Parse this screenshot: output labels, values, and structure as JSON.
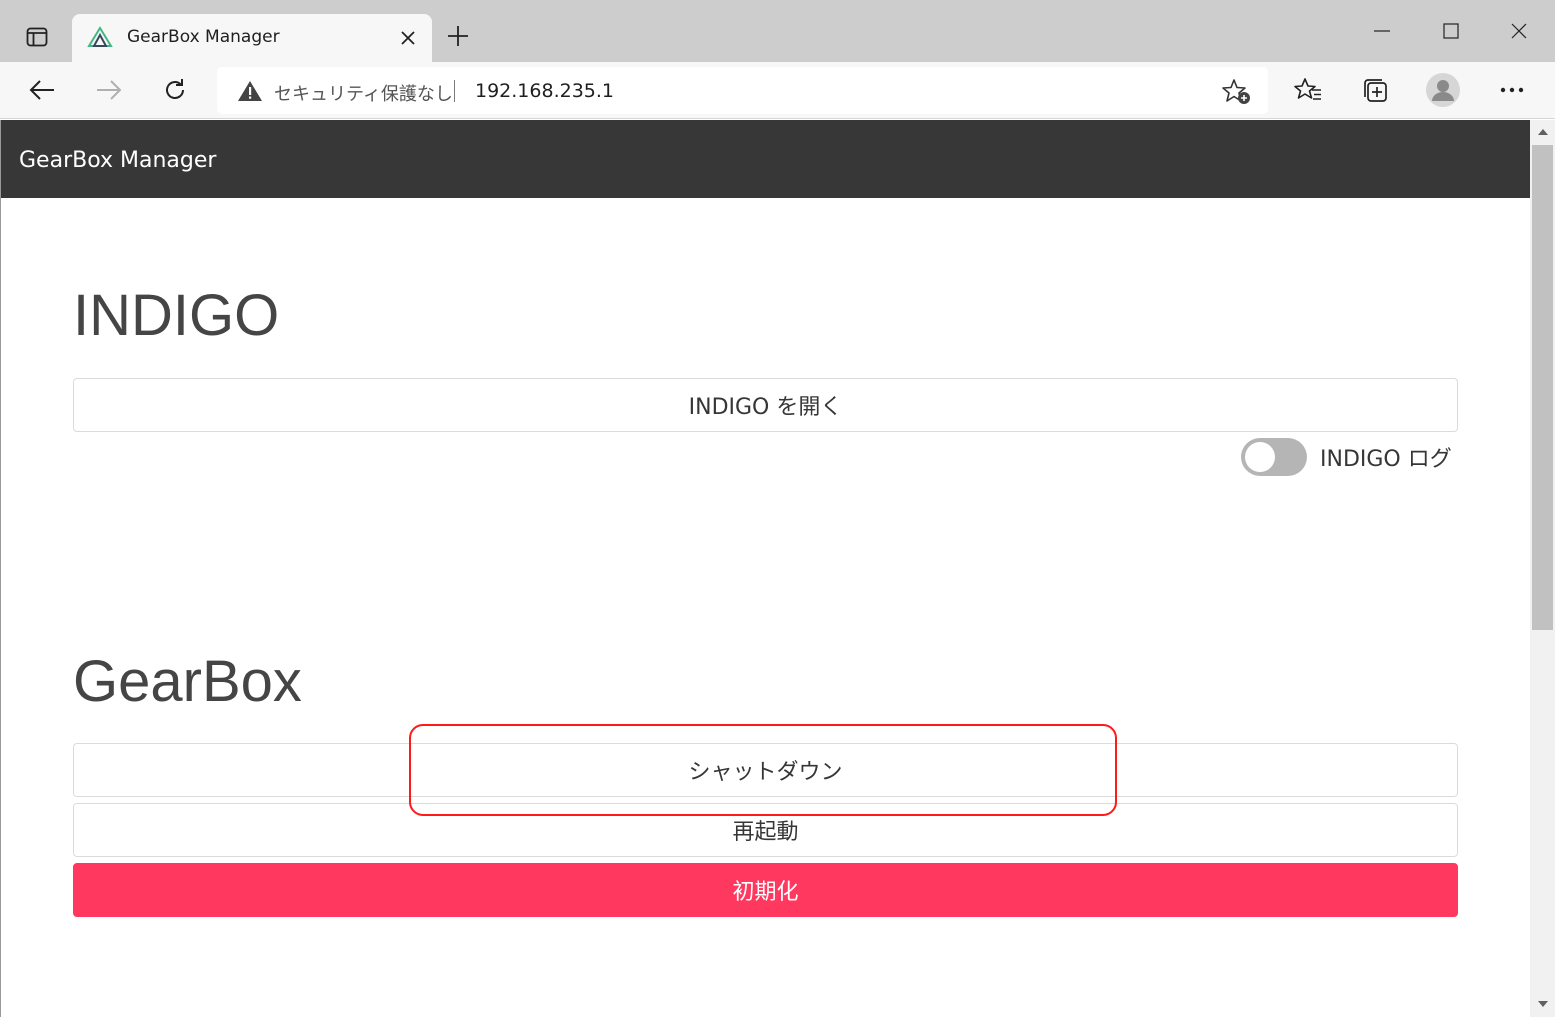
{
  "browser": {
    "tab": {
      "title": "GearBox Manager"
    },
    "address_bar": {
      "security_text": "セキュリティ保護なし",
      "url": "192.168.235.1"
    }
  },
  "page": {
    "brand": "GearBox Manager",
    "indigo": {
      "heading": "INDIGO",
      "open_button": "INDIGO を開く",
      "log_toggle": {
        "label": "INDIGO ログ",
        "state": "off"
      }
    },
    "gearbox": {
      "heading": "GearBox",
      "shutdown_button": "シャットダウン",
      "reboot_button": "再起動",
      "reset_button": "初期化"
    }
  },
  "colors": {
    "navbar": "#373737",
    "danger": "#ff3860",
    "highlight": "#ff1a1a"
  },
  "icons": [
    "tab-actions-icon",
    "edge-favicon-icon",
    "close-icon",
    "plus-icon",
    "minimize-icon",
    "maximize-icon",
    "window-close-icon",
    "back-arrow-icon",
    "forward-arrow-icon",
    "reload-icon",
    "warning-icon",
    "add-favorite-icon",
    "favorites-icon",
    "collections-icon",
    "profile-icon",
    "more-icon"
  ]
}
